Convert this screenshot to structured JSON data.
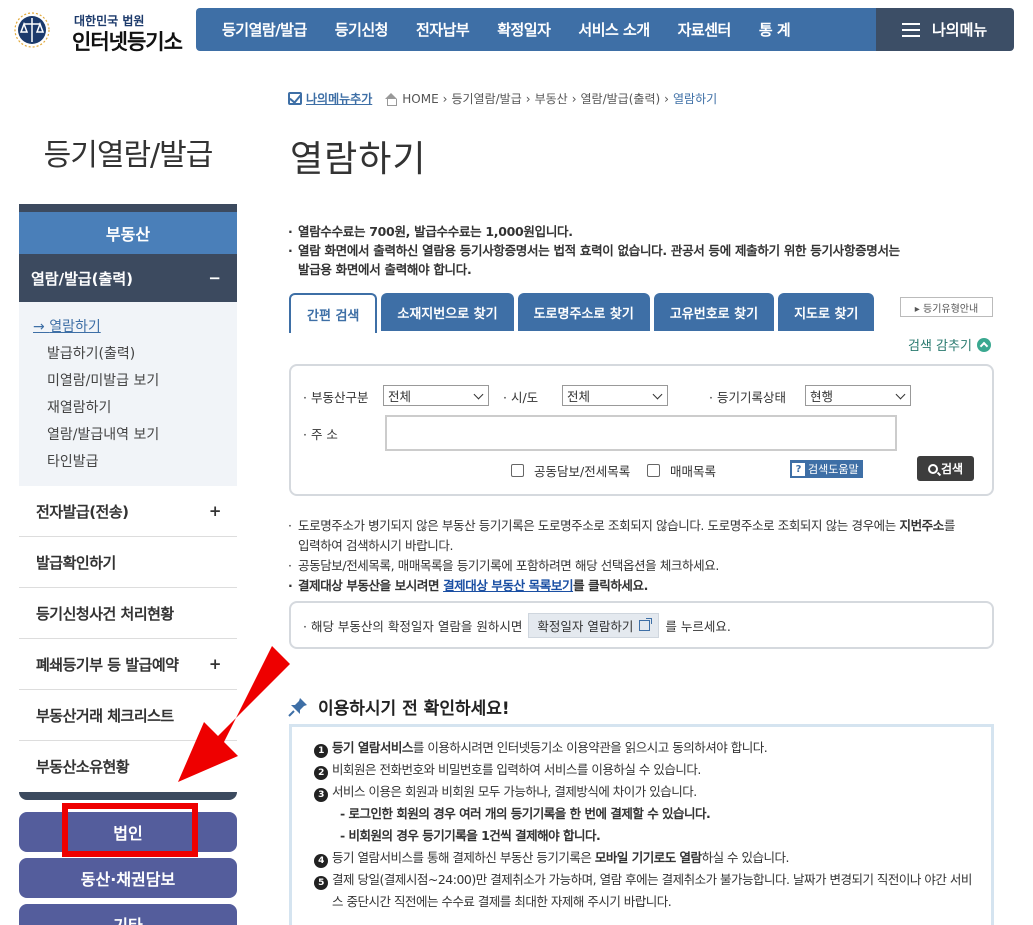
{
  "header": {
    "logo_sub": "대한민국 법원",
    "logo_main": "인터넷등기소",
    "nav": [
      "등기열람/발급",
      "등기신청",
      "전자납부",
      "확정일자",
      "서비스 소개",
      "자료센터",
      "통 계"
    ],
    "mymenu": "나의메뉴"
  },
  "breadcrumb": {
    "add_menu": "나의메뉴추가",
    "items": [
      "HOME",
      "등기열람/발급",
      "부동산",
      "열람/발급(출력)"
    ],
    "current": "열람하기"
  },
  "section_title": "등기열람/발급",
  "page_title": "열람하기",
  "sidebar": {
    "head": "부동산",
    "open_item": "열람/발급(출력)",
    "open_toggle": "−",
    "sub_items": [
      "열람하기",
      "발급하기(출력)",
      "미열람/미발급 보기",
      "재열람하기",
      "열람/발급내역 보기",
      "타인발급"
    ],
    "items": [
      {
        "label": "전자발급(전송)",
        "toggle": "+"
      },
      {
        "label": "발급확인하기",
        "toggle": ""
      },
      {
        "label": "등기신청사건 처리현황",
        "toggle": ""
      },
      {
        "label": "폐쇄등기부 등 발급예약",
        "toggle": "+"
      },
      {
        "label": "부동산거래 체크리스트",
        "toggle": ""
      },
      {
        "label": "부동산소유현황",
        "toggle": ""
      }
    ],
    "buttons": [
      "법인",
      "동산·채권담보",
      "기타"
    ]
  },
  "notes_top": {
    "line1": "열람수수료는 700원, 발급수수료는 1,000원입니다.",
    "line2a": "열람 화면에서 출력하신 열람용 등기사항증명서는 법적 효력이 없습니다. 관공서 등에 제출하기 위한 등기사항증명서는",
    "line2b": "발급용 화면에서 출력해야 합니다."
  },
  "tabs": [
    "간편 검색",
    "소재지번으로 찾기",
    "도로명주소로 찾기",
    "고유번호로 찾기",
    "지도로 찾기"
  ],
  "type_guide": "▸ 등기유형안내",
  "collapse": "검색 감추기",
  "search": {
    "type_label": "부동산구분",
    "type_value": "전체",
    "sido_label": "시/도",
    "sido_value": "전체",
    "status_label": "등기기록상태",
    "status_value": "현행",
    "addr_label": "주 소",
    "addr_value": "",
    "chk1": "공동담보/전세목록",
    "chk2": "매매목록",
    "help": "검색도움말",
    "help_q": "?",
    "button": "검색"
  },
  "notes_mid": {
    "l1a": "도로명주소가 병기되지 않은 부동산 등기기록은 도로명주소로 조회되지 않습니다. 도로명주소로 조회되지 않는 경우에는 ",
    "l1b": "지번주소",
    "l1c": "를",
    "l1d": "입력하여 검색하시기 바랍니다.",
    "l2": "공동담보/전세목록, 매매목록을 등기기록에 포함하려면 해당 선택옵션을 체크하세요.",
    "l3a": "결제대상 부동산을 보시려면 ",
    "l3link": "결제대상 부동산 목록보기",
    "l3b": "를 클릭하세요."
  },
  "confirm": {
    "pre": "해당 부동산의 확정일자 열람을 원하시면",
    "button": "확정일자 열람하기",
    "post": "를 누르세요."
  },
  "notice": {
    "title": "이용하시기 전 확인하세요!",
    "n1a": "등기 열람서비스",
    "n1b": "를 이용하시려면 인터넷등기소 이용약관을 읽으시고 동의하셔야 합니다.",
    "n2": "비회원은 전화번호와 비밀번호를 입력하여 서비스를 이용하실 수 있습니다.",
    "n3": "서비스 이용은 회원과 비회원 모두 가능하나, 결제방식에 차이가 있습니다.",
    "n3a": "- 로그인한 회원의 경우 여러 개의 등기기록을 한 번에 결제할 수 있습니다.",
    "n3b": "- 비회원의 경우 등기기록을 1건씩 결제해야 합니다.",
    "n4a": "등기 열람서비스를 통해 결제하신 부동산 등기기록은 ",
    "n4b": "모바일 기기로도 열람",
    "n4c": "하실 수 있습니다.",
    "n5a": "결제 당일(결제시점~24:00)만 결제취소가 가능하며, 열람 후에는 결제취소가 불가능합니다. 날짜가 변경되기 직전이나 야간 서비",
    "n5b": "스 중단시간 직전에는 수수료 결제를 최대한 자제해 주시기 바랍니다.",
    "nums": [
      "1",
      "2",
      "3",
      "4",
      "5"
    ]
  },
  "colors": {
    "nav_blue": "#3e6fa6",
    "sidebar_dark": "#3c4a5f",
    "button_purple": "#545d9c",
    "annotation_red": "#ee0000"
  }
}
